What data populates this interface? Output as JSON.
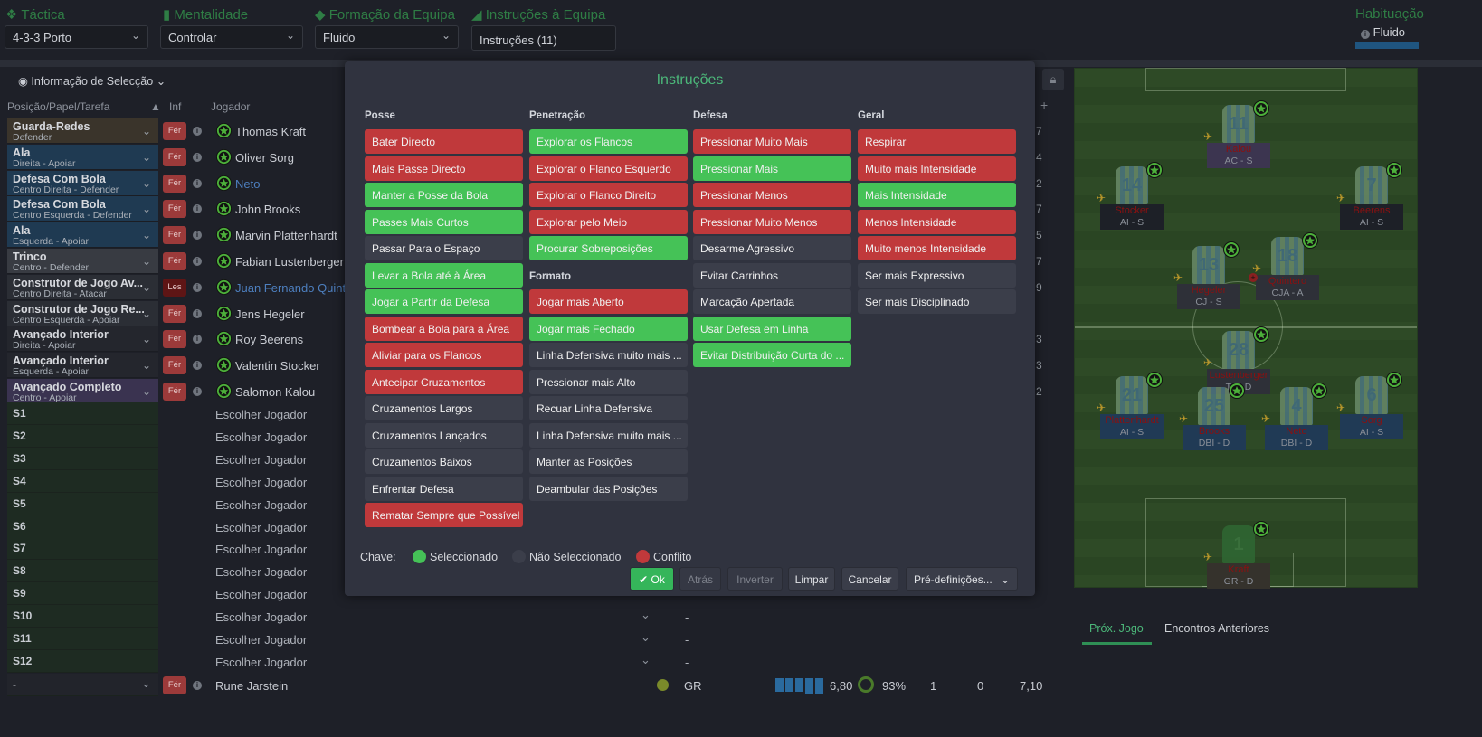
{
  "header": {
    "tactic": {
      "label": "Táctica",
      "value": "4-3-3 Porto"
    },
    "mentality": {
      "label": "Mentalidade",
      "value": "Controlar"
    },
    "formation": {
      "label": "Formação da Equipa",
      "value": "Fluido"
    },
    "team_instructions": {
      "label": "Instruções à Equipa",
      "value": "Instruções (11)"
    },
    "familiarity": {
      "label": "Habituação",
      "value": "Fluido",
      "level_percent": 100
    }
  },
  "selection_info": "Informação de Selecção",
  "table": {
    "headers": {
      "position": "Posição/Papel/Tarefa",
      "inf": "Inf",
      "player": "Jogador"
    },
    "starters": [
      {
        "role": "Guarda-Redes",
        "duty": "Defender",
        "status": "Fér",
        "player": "Thomas Kraft",
        "extra": "7",
        "tone": "gk"
      },
      {
        "role": "Ala",
        "duty": "Direita - Apoiar",
        "status": "Fér",
        "player": "Oliver Sorg",
        "extra": "4",
        "tone": "def"
      },
      {
        "role": "Defesa Com Bola",
        "duty": "Centro Direita - Defender",
        "status": "Fér",
        "player": "Neto",
        "extra": "2",
        "tone": "def",
        "highlight": true
      },
      {
        "role": "Defesa Com Bola",
        "duty": "Centro Esquerda - Defender",
        "status": "Fér",
        "player": "John Brooks",
        "extra": "7",
        "tone": "def"
      },
      {
        "role": "Ala",
        "duty": "Esquerda - Apoiar",
        "status": "Fér",
        "player": "Marvin Plattenhardt",
        "extra": "5",
        "tone": "def"
      },
      {
        "role": "Trinco",
        "duty": "Centro - Defender",
        "status": "Fér",
        "player": "Fabian Lustenberger",
        "extra": "7",
        "tone": "dm"
      },
      {
        "role": "Construtor de Jogo Av...",
        "duty": "Centro Direita - Atacar",
        "status": "Les",
        "player": "Juan Fernando Quintero",
        "extra": "9",
        "tone": "mid",
        "highlight": true
      },
      {
        "role": "Construtor de Jogo Re...",
        "duty": "Centro Esquerda - Apoiar",
        "status": "Fér",
        "player": "Jens Hegeler",
        "extra": "",
        "tone": "mid"
      },
      {
        "role": "Avançado Interior",
        "duty": "Direita - Apoiar",
        "status": "Fér",
        "player": "Roy Beerens",
        "extra": "3",
        "tone": "fw"
      },
      {
        "role": "Avançado Interior",
        "duty": "Esquerda - Apoiar",
        "status": "Fér",
        "player": "Valentin Stocker",
        "extra": "3",
        "tone": "fw"
      },
      {
        "role": "Avançado Completo",
        "duty": "Centro - Apoiar",
        "status": "Fér",
        "player": "Salomon Kalou",
        "extra": "2",
        "tone": "st"
      }
    ],
    "subs": [
      "S1",
      "S2",
      "S3",
      "S4",
      "S5",
      "S6",
      "S7",
      "S8",
      "S9",
      "S10",
      "S11",
      "S12"
    ],
    "choose_player": "Escolher Jogador",
    "empty_value": "-",
    "reserve": {
      "position": "-",
      "status": "Fér",
      "player": "Rune Jarstein",
      "pos": "GR",
      "rating": "6,80",
      "condition": "93%",
      "col1": "1",
      "col2": "0",
      "avg": "7,10",
      "form_bars": 5
    }
  },
  "dialog": {
    "title": "Instruções",
    "columns": [
      {
        "title": "Posse",
        "items": [
          {
            "label": "Bater Directo",
            "state": "red"
          },
          {
            "label": "Mais Passe Directo",
            "state": "red"
          },
          {
            "label": "Manter a Posse da Bola",
            "state": "green"
          },
          {
            "label": "Passes Mais Curtos",
            "state": "green"
          },
          {
            "label": "Passar Para o Espaço",
            "state": "none"
          },
          {
            "label": "Levar a Bola até à Área",
            "state": "green"
          },
          {
            "label": "Jogar a Partir da Defesa",
            "state": "green"
          },
          {
            "label": "Bombear a Bola para a Área",
            "state": "red"
          },
          {
            "label": "Aliviar para os Flancos",
            "state": "red"
          },
          {
            "label": "Antecipar Cruzamentos",
            "state": "red"
          },
          {
            "label": "Cruzamentos Largos",
            "state": "none"
          },
          {
            "label": "Cruzamentos Lançados",
            "state": "none"
          },
          {
            "label": "Cruzamentos Baixos",
            "state": "none"
          },
          {
            "label": "Enfrentar Defesa",
            "state": "none"
          },
          {
            "label": "Rematar Sempre que Possível",
            "state": "red"
          }
        ]
      },
      {
        "title": "Penetração",
        "items": [
          {
            "label": "Explorar os Flancos",
            "state": "green"
          },
          {
            "label": "Explorar o Flanco Esquerdo",
            "state": "red"
          },
          {
            "label": "Explorar o Flanco Direito",
            "state": "red"
          },
          {
            "label": "Explorar pelo Meio",
            "state": "red"
          },
          {
            "label": "Procurar Sobreposições",
            "state": "green"
          }
        ],
        "subtitle": "Formato",
        "items2": [
          {
            "label": "Jogar mais Aberto",
            "state": "red"
          },
          {
            "label": "Jogar mais Fechado",
            "state": "green"
          },
          {
            "label": "Linha Defensiva muito mais ...",
            "state": "none"
          },
          {
            "label": "Pressionar mais Alto",
            "state": "none"
          },
          {
            "label": "Recuar Linha Defensiva",
            "state": "none"
          },
          {
            "label": "Linha Defensiva muito mais ...",
            "state": "none"
          },
          {
            "label": "Manter as Posições",
            "state": "none"
          },
          {
            "label": "Deambular das Posições",
            "state": "none"
          }
        ]
      },
      {
        "title": "Defesa",
        "items": [
          {
            "label": "Pressionar Muito Mais",
            "state": "red"
          },
          {
            "label": "Pressionar Mais",
            "state": "green"
          },
          {
            "label": "Pressionar Menos",
            "state": "red"
          },
          {
            "label": "Pressionar Muito Menos",
            "state": "red"
          },
          {
            "label": "Desarme Agressivo",
            "state": "none"
          },
          {
            "label": "Evitar Carrinhos",
            "state": "none"
          },
          {
            "label": "Marcação Apertada",
            "state": "none"
          },
          {
            "label": "Usar Defesa em Linha",
            "state": "green"
          },
          {
            "label": "Evitar Distribuição Curta do ...",
            "state": "green"
          }
        ]
      },
      {
        "title": "Geral",
        "items": [
          {
            "label": "Respirar",
            "state": "red"
          },
          {
            "label": "Muito mais Intensidade",
            "state": "red"
          },
          {
            "label": "Mais Intensidade",
            "state": "green"
          },
          {
            "label": "Menos Intensidade",
            "state": "red"
          },
          {
            "label": "Muito menos Intensidade",
            "state": "red"
          },
          {
            "label": "Ser mais Expressivo",
            "state": "none"
          },
          {
            "label": "Ser mais Disciplinado",
            "state": "none"
          }
        ]
      }
    ],
    "key": {
      "label": "Chave:",
      "selected": "Seleccionado",
      "not_selected": "Não Seleccionado",
      "conflict": "Conflito"
    },
    "buttons": {
      "ok": "Ok",
      "back": "Atrás",
      "invert": "Inverter",
      "clear": "Limpar",
      "cancel": "Cancelar",
      "presets": "Pré-definições..."
    }
  },
  "pitch": {
    "players": [
      {
        "name": "Kalou",
        "role": "AC - S",
        "number": "11",
        "tone": "purple"
      },
      {
        "name": "Stocker",
        "role": "AI - S",
        "number": "14",
        "tone": "dark"
      },
      {
        "name": "Beerens",
        "role": "AI - S",
        "number": "7",
        "tone": "dark"
      },
      {
        "name": "Hegeler",
        "role": "CJ - S",
        "number": "13",
        "tone": "gray"
      },
      {
        "name": "Quintero",
        "role": "CJA - A",
        "number": "18",
        "tone": "gray",
        "injured": true
      },
      {
        "name": "Lustenberger",
        "role": "Tri - D",
        "number": "28",
        "tone": "gray"
      },
      {
        "name": "Plattenhardt",
        "role": "AI - S",
        "number": "21",
        "tone": "blue"
      },
      {
        "name": "Brooks",
        "role": "DBI - D",
        "number": "25",
        "tone": "blue"
      },
      {
        "name": "Neto",
        "role": "DBI - D",
        "number": "4",
        "tone": "blue"
      },
      {
        "name": "Sorg",
        "role": "AI - S",
        "number": "6",
        "tone": "blue"
      },
      {
        "name": "Kraft",
        "role": "GR - D",
        "number": "1",
        "tone": "brown",
        "gk": true
      }
    ]
  },
  "tabs": [
    {
      "label": "Próx. Jogo",
      "active": true
    },
    {
      "label": "Encontros Anteriores",
      "active": false
    }
  ],
  "colors": {
    "selected": "#45c257",
    "conflict": "#c0393b",
    "not_selected": "#3b3e4a",
    "accent": "#4cb87a"
  }
}
